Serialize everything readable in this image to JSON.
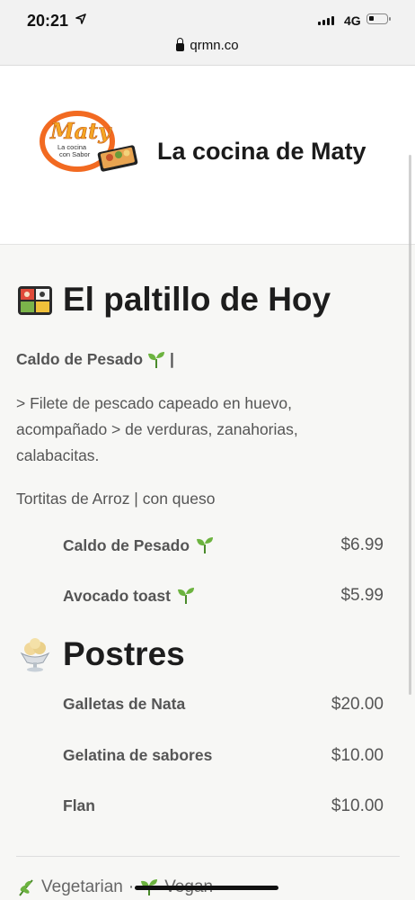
{
  "status_bar": {
    "time": "20:21",
    "network": "4G"
  },
  "url_bar": {
    "url": "qrmn.co"
  },
  "header": {
    "logo_text": "Maty",
    "logo_subtitle_1": "La cocina",
    "logo_subtitle_2": "con Sabor",
    "brand_name": "La cocina de Maty"
  },
  "section_today": {
    "title": "El paltillo de Hoy",
    "line1": "Caldo de Pesado",
    "line1_suffix": "|",
    "line2": "> Filete de pescado capeado en huevo,",
    "line3": "acompañado > de verduras, zanahorias,",
    "line4": "calabacitas.",
    "line5": "Tortitas de Arroz | con queso",
    "items": [
      {
        "name": "Caldo de Pesado",
        "price": "$6.99",
        "vegan": true
      },
      {
        "name": "Avocado toast",
        "price": "$5.99",
        "vegan": true
      }
    ]
  },
  "section_desserts": {
    "title": "Postres",
    "items": [
      {
        "name": "Galletas de Nata",
        "price": "$20.00"
      },
      {
        "name": "Gelatina de sabores",
        "price": "$10.00"
      },
      {
        "name": "Flan",
        "price": "$10.00"
      }
    ]
  },
  "footer": {
    "vegetarian": "Vegetarian",
    "separator": "·",
    "vegan": "Vegan"
  },
  "colors": {
    "accent_orange": "#f26a21",
    "text": "#555555"
  }
}
